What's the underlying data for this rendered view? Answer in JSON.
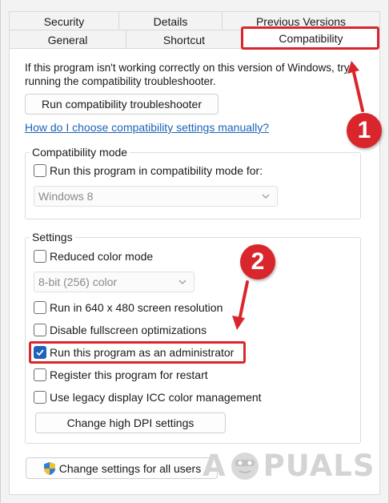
{
  "tabs": {
    "row1": [
      "Security",
      "Details",
      "Previous Versions"
    ],
    "row2": [
      "General",
      "Shortcut",
      "Compatibility"
    ],
    "active": "Compatibility"
  },
  "intro_text": "If this program isn't working correctly on this version of Windows, try running the compatibility troubleshooter.",
  "troubleshooter_button": "Run compatibility troubleshooter",
  "help_link": "How do I choose compatibility settings manually?",
  "compat_mode": {
    "legend": "Compatibility mode",
    "checkbox_label": "Run this program in compatibility mode for:",
    "checked": false,
    "select_value": "Windows 8"
  },
  "settings": {
    "legend": "Settings",
    "reduced_color": {
      "label": "Reduced color mode",
      "checked": false
    },
    "color_select_value": "8-bit (256) color",
    "resolution": {
      "label": "Run in 640 x 480 screen resolution",
      "checked": false
    },
    "fullscreen": {
      "label": "Disable fullscreen optimizations",
      "checked": false
    },
    "admin": {
      "label": "Run this program as an administrator",
      "checked": true
    },
    "restart": {
      "label": "Register this program for restart",
      "checked": false
    },
    "icc": {
      "label": "Use legacy display ICC color management",
      "checked": false
    },
    "dpi_button": "Change high DPI settings"
  },
  "all_users_button": "Change settings for all users",
  "annotations": {
    "badge1": "1",
    "badge2": "2",
    "color": "#d9262c"
  },
  "watermark": {
    "left": "A",
    "right": "PUALS"
  },
  "colors": {
    "accent": "#1e63b8",
    "link": "#1e63b8",
    "highlight": "#d9262c"
  }
}
